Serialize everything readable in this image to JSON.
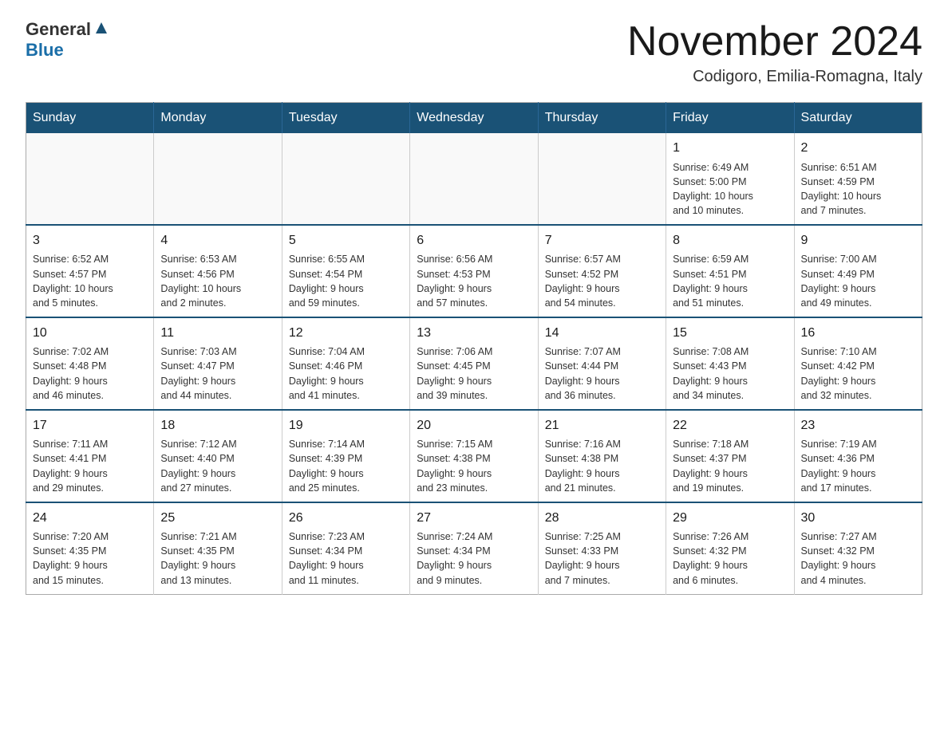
{
  "logo": {
    "text_general": "General",
    "text_blue": "Blue"
  },
  "title": "November 2024",
  "subtitle": "Codigoro, Emilia-Romagna, Italy",
  "weekdays": [
    "Sunday",
    "Monday",
    "Tuesday",
    "Wednesday",
    "Thursday",
    "Friday",
    "Saturday"
  ],
  "weeks": [
    [
      {
        "day": "",
        "info": ""
      },
      {
        "day": "",
        "info": ""
      },
      {
        "day": "",
        "info": ""
      },
      {
        "day": "",
        "info": ""
      },
      {
        "day": "",
        "info": ""
      },
      {
        "day": "1",
        "info": "Sunrise: 6:49 AM\nSunset: 5:00 PM\nDaylight: 10 hours\nand 10 minutes."
      },
      {
        "day": "2",
        "info": "Sunrise: 6:51 AM\nSunset: 4:59 PM\nDaylight: 10 hours\nand 7 minutes."
      }
    ],
    [
      {
        "day": "3",
        "info": "Sunrise: 6:52 AM\nSunset: 4:57 PM\nDaylight: 10 hours\nand 5 minutes."
      },
      {
        "day": "4",
        "info": "Sunrise: 6:53 AM\nSunset: 4:56 PM\nDaylight: 10 hours\nand 2 minutes."
      },
      {
        "day": "5",
        "info": "Sunrise: 6:55 AM\nSunset: 4:54 PM\nDaylight: 9 hours\nand 59 minutes."
      },
      {
        "day": "6",
        "info": "Sunrise: 6:56 AM\nSunset: 4:53 PM\nDaylight: 9 hours\nand 57 minutes."
      },
      {
        "day": "7",
        "info": "Sunrise: 6:57 AM\nSunset: 4:52 PM\nDaylight: 9 hours\nand 54 minutes."
      },
      {
        "day": "8",
        "info": "Sunrise: 6:59 AM\nSunset: 4:51 PM\nDaylight: 9 hours\nand 51 minutes."
      },
      {
        "day": "9",
        "info": "Sunrise: 7:00 AM\nSunset: 4:49 PM\nDaylight: 9 hours\nand 49 minutes."
      }
    ],
    [
      {
        "day": "10",
        "info": "Sunrise: 7:02 AM\nSunset: 4:48 PM\nDaylight: 9 hours\nand 46 minutes."
      },
      {
        "day": "11",
        "info": "Sunrise: 7:03 AM\nSunset: 4:47 PM\nDaylight: 9 hours\nand 44 minutes."
      },
      {
        "day": "12",
        "info": "Sunrise: 7:04 AM\nSunset: 4:46 PM\nDaylight: 9 hours\nand 41 minutes."
      },
      {
        "day": "13",
        "info": "Sunrise: 7:06 AM\nSunset: 4:45 PM\nDaylight: 9 hours\nand 39 minutes."
      },
      {
        "day": "14",
        "info": "Sunrise: 7:07 AM\nSunset: 4:44 PM\nDaylight: 9 hours\nand 36 minutes."
      },
      {
        "day": "15",
        "info": "Sunrise: 7:08 AM\nSunset: 4:43 PM\nDaylight: 9 hours\nand 34 minutes."
      },
      {
        "day": "16",
        "info": "Sunrise: 7:10 AM\nSunset: 4:42 PM\nDaylight: 9 hours\nand 32 minutes."
      }
    ],
    [
      {
        "day": "17",
        "info": "Sunrise: 7:11 AM\nSunset: 4:41 PM\nDaylight: 9 hours\nand 29 minutes."
      },
      {
        "day": "18",
        "info": "Sunrise: 7:12 AM\nSunset: 4:40 PM\nDaylight: 9 hours\nand 27 minutes."
      },
      {
        "day": "19",
        "info": "Sunrise: 7:14 AM\nSunset: 4:39 PM\nDaylight: 9 hours\nand 25 minutes."
      },
      {
        "day": "20",
        "info": "Sunrise: 7:15 AM\nSunset: 4:38 PM\nDaylight: 9 hours\nand 23 minutes."
      },
      {
        "day": "21",
        "info": "Sunrise: 7:16 AM\nSunset: 4:38 PM\nDaylight: 9 hours\nand 21 minutes."
      },
      {
        "day": "22",
        "info": "Sunrise: 7:18 AM\nSunset: 4:37 PM\nDaylight: 9 hours\nand 19 minutes."
      },
      {
        "day": "23",
        "info": "Sunrise: 7:19 AM\nSunset: 4:36 PM\nDaylight: 9 hours\nand 17 minutes."
      }
    ],
    [
      {
        "day": "24",
        "info": "Sunrise: 7:20 AM\nSunset: 4:35 PM\nDaylight: 9 hours\nand 15 minutes."
      },
      {
        "day": "25",
        "info": "Sunrise: 7:21 AM\nSunset: 4:35 PM\nDaylight: 9 hours\nand 13 minutes."
      },
      {
        "day": "26",
        "info": "Sunrise: 7:23 AM\nSunset: 4:34 PM\nDaylight: 9 hours\nand 11 minutes."
      },
      {
        "day": "27",
        "info": "Sunrise: 7:24 AM\nSunset: 4:34 PM\nDaylight: 9 hours\nand 9 minutes."
      },
      {
        "day": "28",
        "info": "Sunrise: 7:25 AM\nSunset: 4:33 PM\nDaylight: 9 hours\nand 7 minutes."
      },
      {
        "day": "29",
        "info": "Sunrise: 7:26 AM\nSunset: 4:32 PM\nDaylight: 9 hours\nand 6 minutes."
      },
      {
        "day": "30",
        "info": "Sunrise: 7:27 AM\nSunset: 4:32 PM\nDaylight: 9 hours\nand 4 minutes."
      }
    ]
  ]
}
